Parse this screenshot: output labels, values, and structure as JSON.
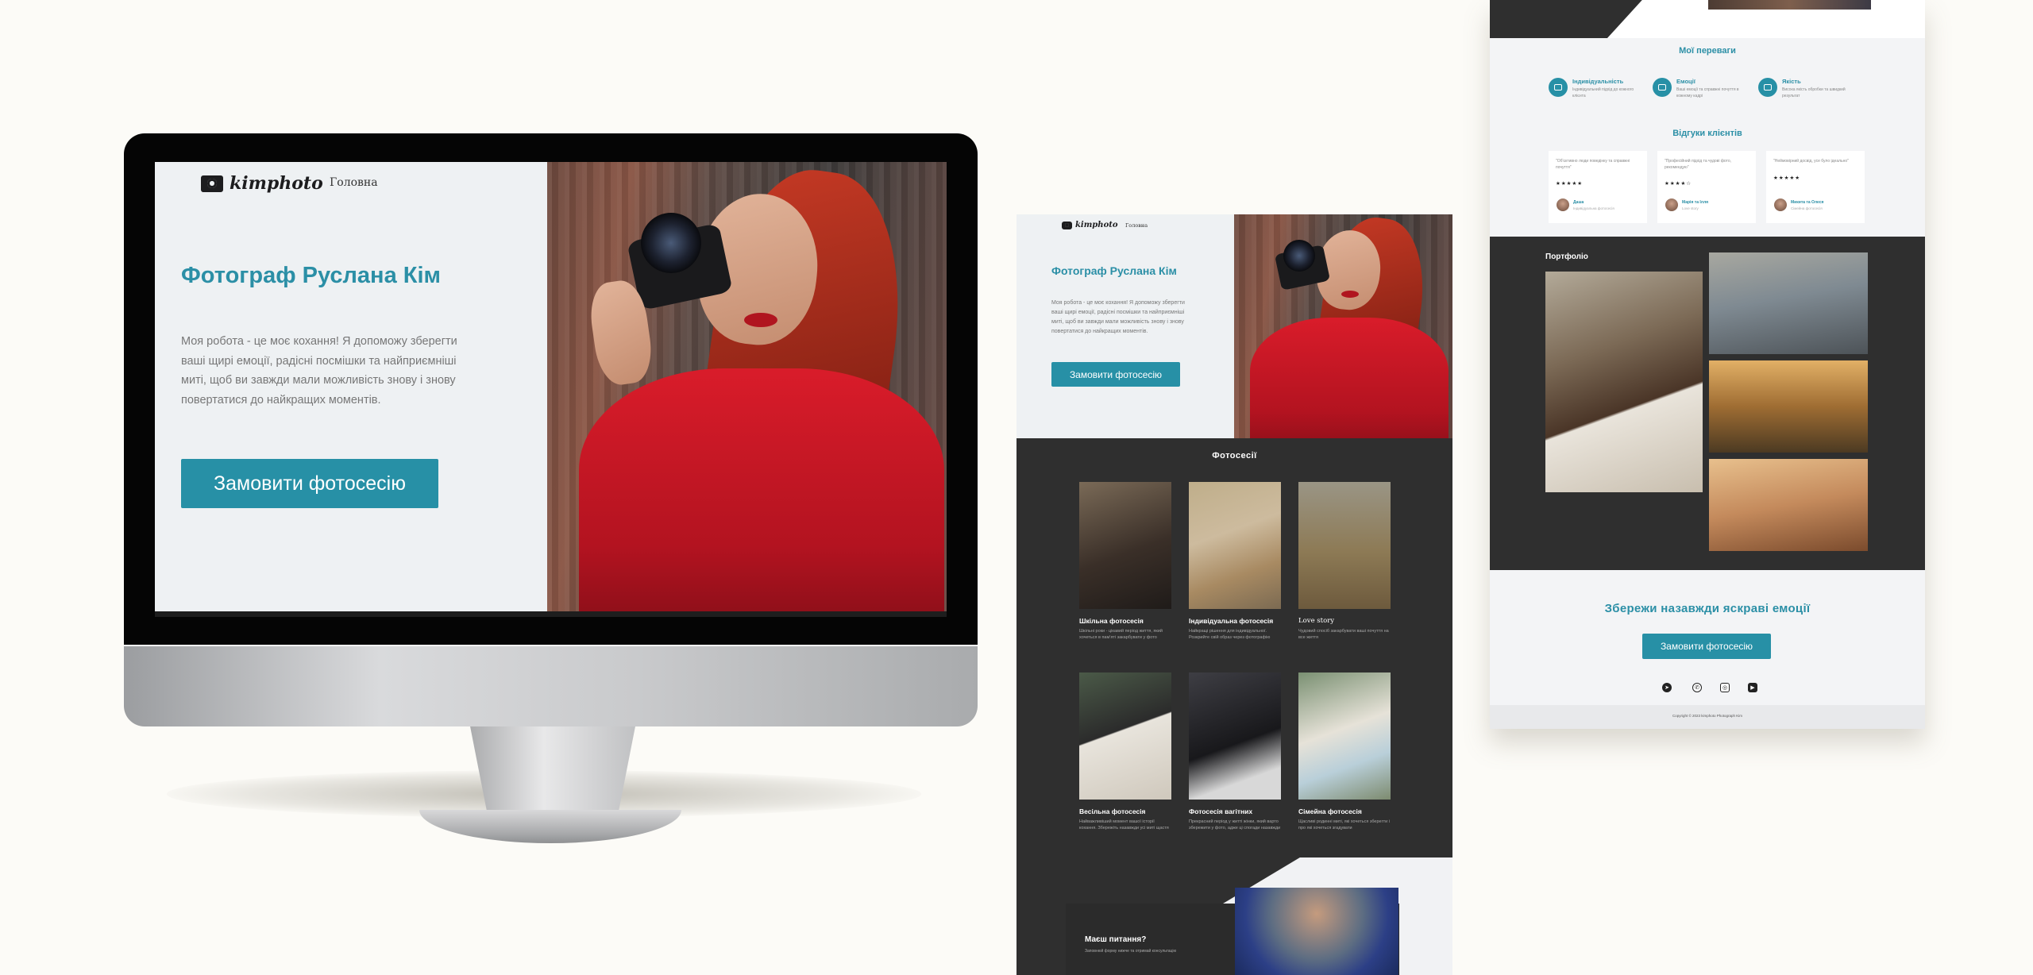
{
  "site": {
    "logo_text": "kimphoto",
    "nav_home": "Головна",
    "hero_title": "Фотограф Руслана Кім",
    "hero_text": "Моя робота - це моє кохання! Я  допоможу зберегти ваші щирі емоції, радісні посмішки та найприємніші миті, щоб ви завжди мали можливість знову і знову повертатися до найкращих моментів.",
    "cta_label": "Замовити фотосесію"
  },
  "sessions": {
    "title": "Фотосесії",
    "cards": [
      {
        "title": "Шкільна фотосесія",
        "desc": "Шкільні роки - цікавий період життя, який хочеться в пам'яті закарбувати у фото"
      },
      {
        "title": "Індивідуальна фотосесія",
        "desc": "Найкращі рішення для індивідуальної. Розкрийте свій образ через фотографію"
      },
      {
        "title": "Love story",
        "desc": "Чудовий спосіб закарбувати ваші почуття на все життя"
      },
      {
        "title": "Весільна фотосесія",
        "desc": "Найважливіший момент вашої історії кохання. Збережіть назавжди усі миті щастя"
      },
      {
        "title": "Фотосесія вагітних",
        "desc": "Прекрасний період у житті жінки, який варто збережити у фото, адже ці спогади назавжди"
      },
      {
        "title": "Сімейна фотосесія",
        "desc": "Щасливі родинні миті, які хочеться зберегти і про які хочеться згадувати"
      }
    ]
  },
  "contact": {
    "title": "Маєш питання?",
    "subtitle": "Заповнюй форму нижче та отримай консультацію"
  },
  "advantages": {
    "title": "Мої переваги",
    "items": [
      {
        "title": "Індивідуальність",
        "desc": "Індивідуальний підхід до кожного клієнта"
      },
      {
        "title": "Емоції",
        "desc": "Ваші емоції та справжні почуття в кожному кадрі"
      },
      {
        "title": "Якість",
        "desc": "Висока якість обробки та швидкий результат"
      }
    ]
  },
  "reviews": {
    "title": "Відгуки клієнтів",
    "items": [
      {
        "quote": "\"Об'єктивно люди поведінку та справжні почуття\"",
        "stars": "★★★★★",
        "name": "Даша",
        "role": "Індивідуальна фотосесія"
      },
      {
        "quote": "\"Професійний підхід та чудові фото, рекомендую\"",
        "stars": "★★★★☆",
        "name": "Марія та Ілля",
        "role": "Love story"
      },
      {
        "quote": "\"Неймовірний досвід, усе було ідеально\"",
        "stars": "★★★★★",
        "name": "Микита та Олеся",
        "role": "Сімейна фотосесія"
      }
    ]
  },
  "portfolio": {
    "title": "Портфоліо"
  },
  "save": {
    "title": "Збережи назавжди яскраві емоції",
    "cta_label": "Замовити фотосесію",
    "social_icons": [
      "telegram-icon",
      "viber-icon",
      "instagram-icon",
      "youtube-icon"
    ]
  },
  "footer": {
    "copyright": "Copyright © 2023 kimphoto Photograph Kim"
  },
  "colors": {
    "accent": "#2790a6",
    "dark": "#2f2f2f",
    "light": "#eef1f3",
    "page_bg": "#fcfbf7"
  }
}
